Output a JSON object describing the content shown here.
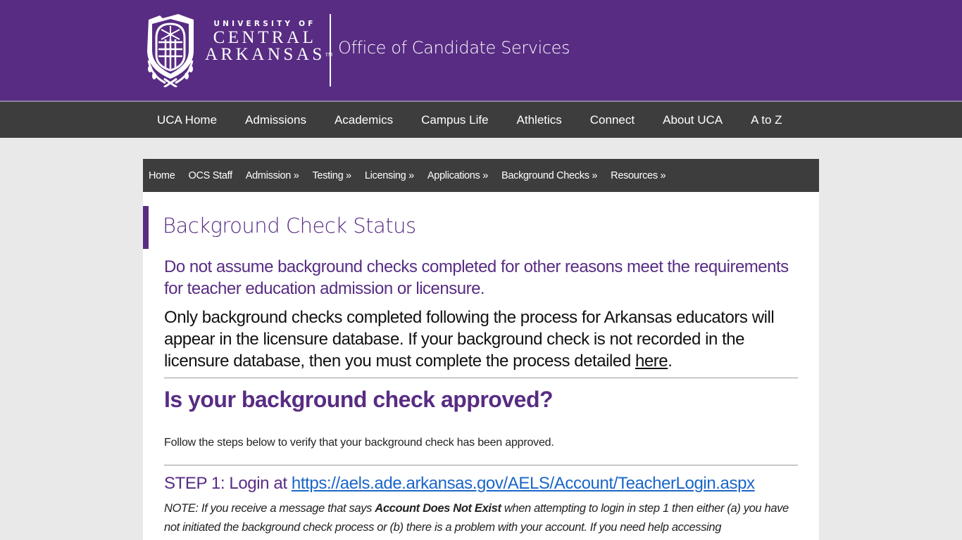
{
  "header": {
    "logo": {
      "line1": "UNIVERSITY OF",
      "line2": "CENTRAL",
      "line3": "ARKANSAS",
      "trademark": "TM",
      "icon": "shield-crest-icon"
    },
    "office_title": "Office of Candidate Services",
    "colors": {
      "brand_purple": "#582c83",
      "nav_dark": "#3d3d3d",
      "link_blue": "#1a66c9"
    }
  },
  "topnav": {
    "items": [
      {
        "label": "UCA Home"
      },
      {
        "label": "Admissions"
      },
      {
        "label": "Academics"
      },
      {
        "label": "Campus Life"
      },
      {
        "label": "Athletics"
      },
      {
        "label": "Connect"
      },
      {
        "label": "About UCA"
      },
      {
        "label": "A to Z"
      }
    ]
  },
  "subnav": {
    "items": [
      {
        "label": "Home"
      },
      {
        "label": "OCS Staff"
      },
      {
        "label": "Admission »"
      },
      {
        "label": "Testing »"
      },
      {
        "label": "Licensing »"
      },
      {
        "label": "Applications »"
      },
      {
        "label": "Background Checks »"
      },
      {
        "label": "Resources »"
      }
    ]
  },
  "page": {
    "title": "Background Check Status",
    "lead_purple": "Do not assume background checks completed for other reasons meet the requirements for teacher education admission or licensure.",
    "lead_black_before_link": "Only background checks completed following the process for Arkansas educators will appear in the licensure database.  If your background check is not recorded in the licensure database, then you must complete the process detailed ",
    "lead_black_link": "here",
    "lead_black_after_link": ".",
    "section_heading": "Is your background check approved?",
    "follow_text": "Follow the steps below to verify that your background check has been approved.",
    "step1_prefix": "STEP 1:  Login at ",
    "step1_link": "https://aels.ade.arkansas.gov/AELS/Account/TeacherLogin.aspx",
    "note_prefix": "NOTE:  If you receive a message that says ",
    "note_bold": "Account Does Not Exist",
    "note_suffix": " when attempting to login in step 1 then either (a) you have not initiated the background check process or (b) there is a problem with your account.  If you need help accessing"
  }
}
